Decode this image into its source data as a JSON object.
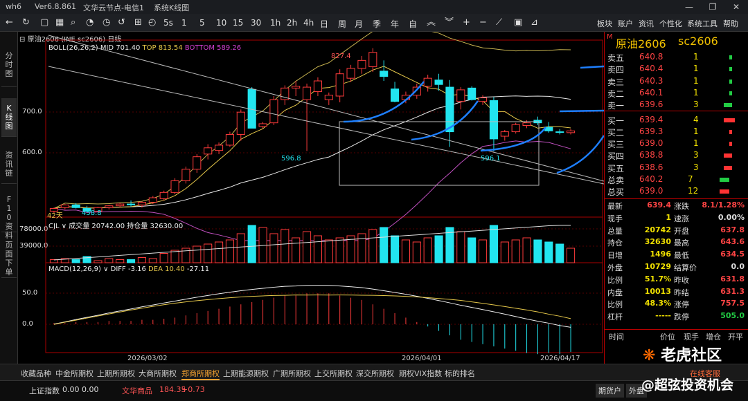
{
  "titlebar": {
    "app": "wh6",
    "version": "Ver6.8.861",
    "server": "文华云节点-电信1",
    "section": "系统K线图"
  },
  "toolbar": {
    "periods": [
      "5s",
      "1",
      "5",
      "10",
      "15",
      "30",
      "1h",
      "2h",
      "4h",
      "日",
      "周",
      "月",
      "季",
      "年",
      "自"
    ],
    "right_items": [
      "板块",
      "账户",
      "资讯",
      "个性化",
      "系统工具",
      "帮助"
    ]
  },
  "leftnav": [
    {
      "label": "分时图"
    },
    {
      "label": "K线图"
    },
    {
      "label": "资讯链"
    },
    {
      "label": "F10资料"
    },
    {
      "label": "页面下单"
    }
  ],
  "chart_header": {
    "symbol": "原油2606",
    "code": "(INE sc2606)",
    "period": "日线"
  },
  "boll": {
    "name": "BOLL(26,26,2)",
    "mid": "MID 701.40",
    "top": "TOP 813.54",
    "bottom": "BOTTOM 589.26"
  },
  "vol": {
    "name": "CJL",
    "volume": "成交量 20742.00",
    "oi": "持仓量 32630.00"
  },
  "macd": {
    "name": "MACD(12,26,9)",
    "diff": "DIFF -3.16",
    "dea": "DEA 10.40",
    "value": "-27.11"
  },
  "price_axis": {
    "labels": [
      "700.0",
      "600.0"
    ]
  },
  "vol_axis": {
    "labels": [
      "78000.0",
      "39000.0"
    ]
  },
  "macd_axis": {
    "labels": [
      "50.0",
      "0.0"
    ]
  },
  "annotations": {
    "high": "827.4",
    "low1": "596.8",
    "low2": "596.1",
    "low0": "458.8",
    "days": "42天"
  },
  "dates": [
    "2026/03/02",
    "2026/04/01",
    "2026/04/17"
  ],
  "colors": {
    "up": "#ff3b3b",
    "down": "#22e5ef",
    "boll_mid": "#e8e8e8",
    "boll_top": "#c8b450",
    "boll_bottom": "#c050c0",
    "trend_blue": "#1e7fff",
    "bg": "#000000"
  },
  "chart_data": {
    "type": "candlestick",
    "ylim": [
      458,
      830
    ],
    "candles": [
      {
        "o": 462,
        "h": 470,
        "l": 458,
        "c": 468
      },
      {
        "o": 470,
        "h": 478,
        "l": 466,
        "c": 476
      },
      {
        "o": 476,
        "h": 480,
        "l": 468,
        "c": 470
      },
      {
        "o": 468,
        "h": 474,
        "l": 458.8,
        "c": 462
      },
      {
        "o": 462,
        "h": 472,
        "l": 460,
        "c": 470
      },
      {
        "o": 470,
        "h": 476,
        "l": 466,
        "c": 474
      },
      {
        "o": 474,
        "h": 480,
        "l": 470,
        "c": 478
      },
      {
        "o": 478,
        "h": 486,
        "l": 472,
        "c": 476
      },
      {
        "o": 476,
        "h": 484,
        "l": 470,
        "c": 482
      },
      {
        "o": 482,
        "h": 496,
        "l": 478,
        "c": 492
      },
      {
        "o": 490,
        "h": 508,
        "l": 486,
        "c": 504
      },
      {
        "o": 504,
        "h": 536,
        "l": 500,
        "c": 530
      },
      {
        "o": 530,
        "h": 562,
        "l": 524,
        "c": 556
      },
      {
        "o": 556,
        "h": 590,
        "l": 548,
        "c": 584
      },
      {
        "o": 590,
        "h": 612,
        "l": 578,
        "c": 604
      },
      {
        "o": 598,
        "h": 616,
        "l": 590,
        "c": 610
      },
      {
        "o": 610,
        "h": 640,
        "l": 606,
        "c": 634
      },
      {
        "o": 634,
        "h": 690,
        "l": 620,
        "c": 684
      },
      {
        "o": 735,
        "h": 740,
        "l": 650,
        "c": 648
      },
      {
        "o": 652,
        "h": 662,
        "l": 648,
        "c": 658
      },
      {
        "o": 660,
        "h": 720,
        "l": 655,
        "c": 712
      },
      {
        "o": 712,
        "h": 744,
        "l": 700,
        "c": 738
      },
      {
        "o": 738,
        "h": 754,
        "l": 720,
        "c": 742
      },
      {
        "o": 712,
        "h": 748,
        "l": 596.8,
        "c": 740
      },
      {
        "o": 730,
        "h": 762,
        "l": 720,
        "c": 754
      },
      {
        "o": 712,
        "h": 728,
        "l": 700,
        "c": 722
      },
      {
        "o": 720,
        "h": 780,
        "l": 706,
        "c": 770
      },
      {
        "o": 760,
        "h": 790,
        "l": 752,
        "c": 782
      },
      {
        "o": 782,
        "h": 810,
        "l": 770,
        "c": 800
      },
      {
        "o": 786,
        "h": 827.4,
        "l": 774,
        "c": 818
      },
      {
        "o": 776,
        "h": 800,
        "l": 754,
        "c": 764
      },
      {
        "o": 736,
        "h": 752,
        "l": 706,
        "c": 708
      },
      {
        "o": 712,
        "h": 730,
        "l": 704,
        "c": 722
      },
      {
        "o": 722,
        "h": 748,
        "l": 714,
        "c": 740
      },
      {
        "o": 742,
        "h": 768,
        "l": 730,
        "c": 760
      },
      {
        "o": 756,
        "h": 770,
        "l": 732,
        "c": 746
      },
      {
        "o": 740,
        "h": 756,
        "l": 606,
        "c": 640
      },
      {
        "o": 708,
        "h": 740,
        "l": 690,
        "c": 734
      },
      {
        "o": 738,
        "h": 742,
        "l": 710,
        "c": 712
      },
      {
        "o": 708,
        "h": 722,
        "l": 700,
        "c": 716
      },
      {
        "o": 710,
        "h": 718,
        "l": 596.1,
        "c": 624
      },
      {
        "o": 630,
        "h": 644,
        "l": 620,
        "c": 640
      },
      {
        "o": 640,
        "h": 660,
        "l": 636,
        "c": 656
      },
      {
        "o": 654,
        "h": 666,
        "l": 648,
        "c": 660
      },
      {
        "o": 666,
        "h": 674,
        "l": 655,
        "c": 660
      },
      {
        "o": 650,
        "h": 662,
        "l": 638,
        "c": 642
      },
      {
        "o": 640,
        "h": 646,
        "l": 634,
        "c": 639.4
      },
      {
        "o": 638,
        "h": 646,
        "l": 634,
        "c": 642
      }
    ],
    "volume": [
      3,
      4,
      3,
      6,
      2,
      4,
      3,
      3,
      5,
      4,
      9,
      12,
      14,
      16,
      18,
      20,
      22,
      28,
      36,
      34,
      28,
      32,
      24,
      30,
      26,
      22,
      24,
      26,
      28,
      32,
      34,
      26,
      22,
      20,
      24,
      26,
      34,
      30,
      24,
      22,
      36,
      20,
      22,
      24,
      22,
      20,
      18,
      14
    ],
    "macd_hist": [
      1,
      1,
      2,
      2,
      2,
      3,
      3,
      3,
      4,
      4,
      5,
      6,
      8,
      10,
      12,
      14,
      16,
      18,
      20,
      22,
      24,
      26,
      26,
      28,
      28,
      28,
      26,
      24,
      22,
      18,
      14,
      10,
      6,
      2,
      -2,
      -6,
      -10,
      -14,
      -16,
      -18,
      -20,
      -22,
      -24,
      -26,
      -27,
      -26,
      -27.11,
      -25
    ]
  },
  "quote": {
    "header_symbol": "原油2606",
    "header_code": "sc2606",
    "asks": [
      {
        "label": "卖五",
        "price": "640.8",
        "vol": "1"
      },
      {
        "label": "卖四",
        "price": "640.4",
        "vol": "1"
      },
      {
        "label": "卖三",
        "price": "640.3",
        "vol": "1"
      },
      {
        "label": "卖二",
        "price": "640.1",
        "vol": "1"
      },
      {
        "label": "卖一",
        "price": "639.6",
        "vol": "3"
      }
    ],
    "bids": [
      {
        "label": "买一",
        "price": "639.4",
        "vol": "4"
      },
      {
        "label": "买二",
        "price": "639.3",
        "vol": "1"
      },
      {
        "label": "买三",
        "price": "639.0",
        "vol": "1"
      },
      {
        "label": "买四",
        "price": "638.8",
        "vol": "3"
      },
      {
        "label": "买五",
        "price": "638.6",
        "vol": "3"
      }
    ],
    "totals": [
      {
        "label": "总卖",
        "price": "640.2",
        "vol": "7"
      },
      {
        "label": "总买",
        "price": "639.0",
        "vol": "12"
      }
    ],
    "stats": [
      {
        "l1": "最新",
        "v1": "639.4",
        "l2": "涨跌",
        "v2": "8.1/1.28%"
      },
      {
        "l1": "现手",
        "v1": "1",
        "l2": "速涨",
        "v2": "0.00%"
      },
      {
        "l1": "总量",
        "v1": "20742",
        "l2": "开盘",
        "v2": "637.8"
      },
      {
        "l1": "持仓",
        "v1": "32630",
        "l2": "最高",
        "v2": "643.6"
      },
      {
        "l1": "日增",
        "v1": "1496",
        "l2": "最低",
        "v2": "634.5"
      },
      {
        "l1": "外盘",
        "v1": "10729",
        "l2": "结算价",
        "v2": "0.0"
      },
      {
        "l1": "比例",
        "v1": "51.7%",
        "l2": "昨收",
        "v2": "631.8"
      },
      {
        "l1": "内盘",
        "v1": "10013",
        "l2": "昨结",
        "v2": "631.3"
      },
      {
        "l1": "比例",
        "v1": "48.3%",
        "l2": "涨停",
        "v2": "757.5"
      },
      {
        "l1": "杠杆",
        "v1": "-----",
        "l2": "跌停",
        "v2": "505.0"
      }
    ],
    "tick_header": [
      "时间",
      "价位",
      "现手",
      "增仓",
      "开平"
    ]
  },
  "bottom_tabs": [
    "收藏品种",
    "中金所期权",
    "上期所期权",
    "大商所期权",
    "郑商所期权",
    "上期能源期权",
    "广期所期权",
    "上交所期权",
    "深交所期权",
    "期权VIX指数",
    "标的排名"
  ],
  "status": {
    "index_name": "上证指数",
    "index_val": "0.00",
    "index_chg": "0.00",
    "commodity_name": "文华商品",
    "commodity_val": "184.35",
    "commodity_chg": "+0.73",
    "btn1": "期货户",
    "btn2": "外盘",
    "service": "在线客服"
  },
  "watermark": {
    "line1": "老虎社区",
    "line2": "@超弦投资机会"
  }
}
